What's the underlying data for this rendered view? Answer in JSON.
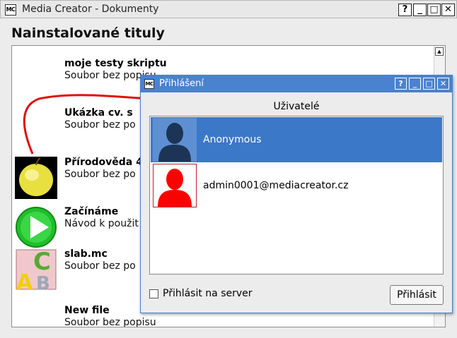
{
  "window": {
    "icon_text": "MC",
    "title": "Media Creator - Dokumenty",
    "help_btn": "?",
    "min_btn": "_",
    "max_btn": "□",
    "close_btn": "✕"
  },
  "main": {
    "heading": "Nainstalované tituly",
    "items": [
      {
        "title": "moje testy skriptu",
        "desc": "Soubor bez popisu",
        "thumb": "none"
      },
      {
        "title": "Ukázka cv. s",
        "desc": "Soubor bez po",
        "thumb": "none"
      },
      {
        "title": "Přírodověda 4",
        "desc": "Soubor bez po",
        "thumb": "apple-icon"
      },
      {
        "title": "Začínáme",
        "desc": "Návod k použit",
        "thumb": "play-icon"
      },
      {
        "title": "slab.mc",
        "desc": "Soubor bez po",
        "thumb": "abc-icon"
      },
      {
        "title": "New file",
        "desc": "Soubor bez popisu",
        "thumb": "none"
      }
    ]
  },
  "dialog": {
    "icon_text": "MC",
    "title": "Přihlášení",
    "help_btn": "?",
    "min_btn": "_",
    "max_btn": "□",
    "close_btn": "✕",
    "section_label": "Uživatelé",
    "users": [
      {
        "name": "Anonymous",
        "selected": true,
        "avatar": "user-silhouette-dark"
      },
      {
        "name": "admin0001@mediacreator.cz",
        "selected": false,
        "avatar": "user-silhouette-red"
      }
    ],
    "server_checkbox_label": "Přihlásit na server",
    "server_checkbox_checked": false,
    "login_button": "Přihlásit"
  },
  "colors": {
    "dialog_titlebar": "#4a82cf",
    "selection": "#3b78c8",
    "annotation_arrow": "#e01010",
    "admin_avatar": "#ff0000"
  }
}
